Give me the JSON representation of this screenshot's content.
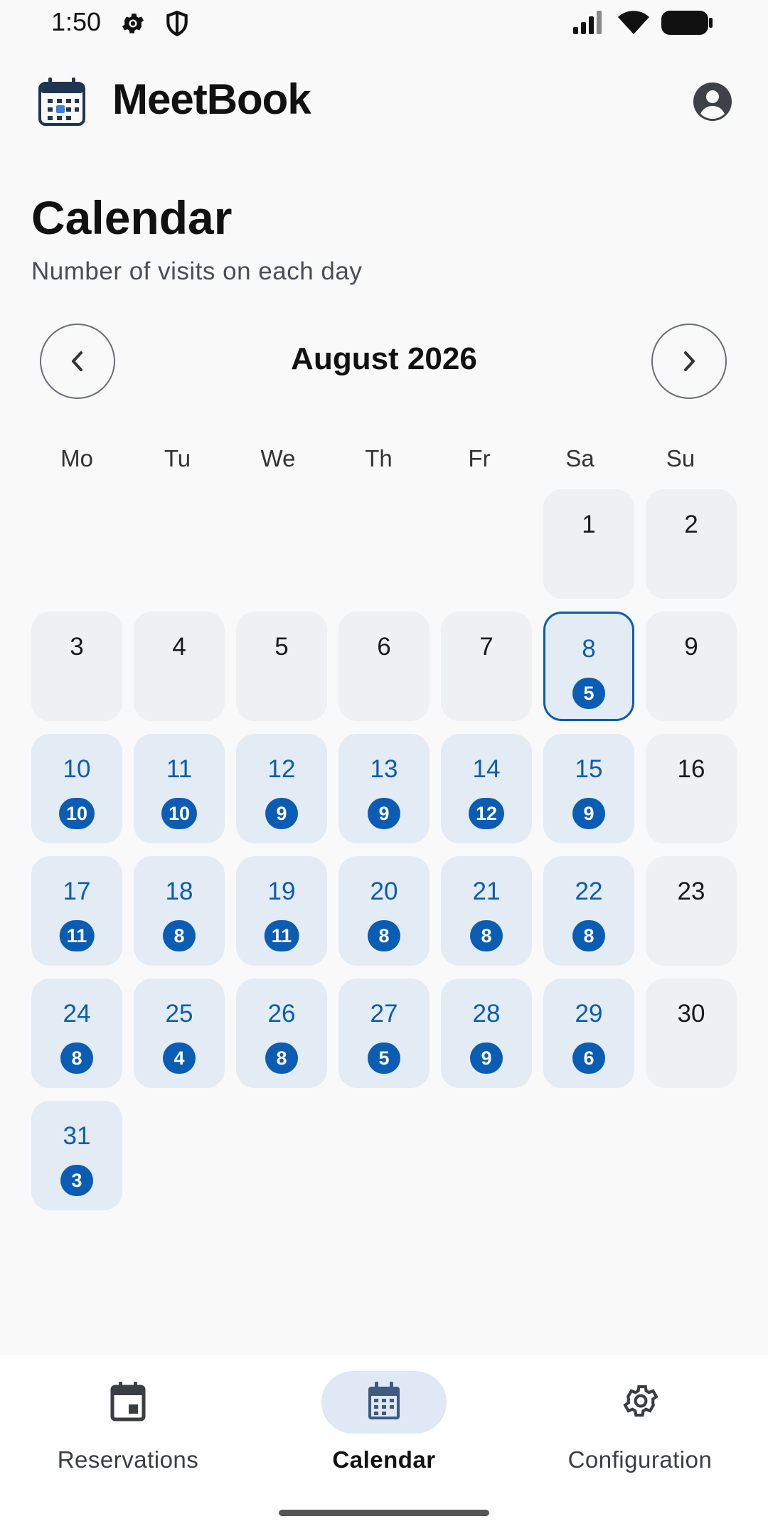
{
  "status_bar": {
    "time": "1:50",
    "icons": [
      "settings-gear-icon",
      "shield-icon",
      "cellular-signal-icon",
      "wifi-icon",
      "battery-icon"
    ]
  },
  "app_bar": {
    "title": "MeetBook",
    "logo_icon": "calendar-logo-icon",
    "account_icon": "account-circle-icon"
  },
  "page": {
    "title": "Calendar",
    "subtitle": "Number of visits on each day"
  },
  "calendar": {
    "month_label": "August 2026",
    "prev_icon": "chevron-left-icon",
    "next_icon": "chevron-right-icon",
    "weekdays": [
      "Mo",
      "Tu",
      "We",
      "Th",
      "Fr",
      "Sa",
      "Su"
    ],
    "first_weekday_index": 5,
    "selected_day": 8,
    "days": [
      {
        "day": "1",
        "visits": null
      },
      {
        "day": "2",
        "visits": null
      },
      {
        "day": "3",
        "visits": null
      },
      {
        "day": "4",
        "visits": null
      },
      {
        "day": "5",
        "visits": null
      },
      {
        "day": "6",
        "visits": null
      },
      {
        "day": "7",
        "visits": null
      },
      {
        "day": "8",
        "visits": "5"
      },
      {
        "day": "9",
        "visits": null
      },
      {
        "day": "10",
        "visits": "10"
      },
      {
        "day": "11",
        "visits": "10"
      },
      {
        "day": "12",
        "visits": "9"
      },
      {
        "day": "13",
        "visits": "9"
      },
      {
        "day": "14",
        "visits": "12"
      },
      {
        "day": "15",
        "visits": "9"
      },
      {
        "day": "16",
        "visits": null
      },
      {
        "day": "17",
        "visits": "11"
      },
      {
        "day": "18",
        "visits": "8"
      },
      {
        "day": "19",
        "visits": "11"
      },
      {
        "day": "20",
        "visits": "8"
      },
      {
        "day": "21",
        "visits": "8"
      },
      {
        "day": "22",
        "visits": "8"
      },
      {
        "day": "23",
        "visits": null
      },
      {
        "day": "24",
        "visits": "8"
      },
      {
        "day": "25",
        "visits": "4"
      },
      {
        "day": "26",
        "visits": "8"
      },
      {
        "day": "27",
        "visits": "5"
      },
      {
        "day": "28",
        "visits": "9"
      },
      {
        "day": "29",
        "visits": "6"
      },
      {
        "day": "30",
        "visits": null
      },
      {
        "day": "31",
        "visits": "3"
      }
    ]
  },
  "bottom_nav": {
    "items": [
      {
        "label": "Reservations",
        "icon": "calendar-event-icon",
        "active": false
      },
      {
        "label": "Calendar",
        "icon": "calendar-month-icon",
        "active": true
      },
      {
        "label": "Configuration",
        "icon": "settings-gear-icon",
        "active": false
      }
    ]
  },
  "colors": {
    "accent": "#0b5cb3",
    "visit_cell_bg": "#e3ebf5",
    "empty_cell_bg": "#eff0f2",
    "active_nav_pill": "#dfe8f4"
  }
}
